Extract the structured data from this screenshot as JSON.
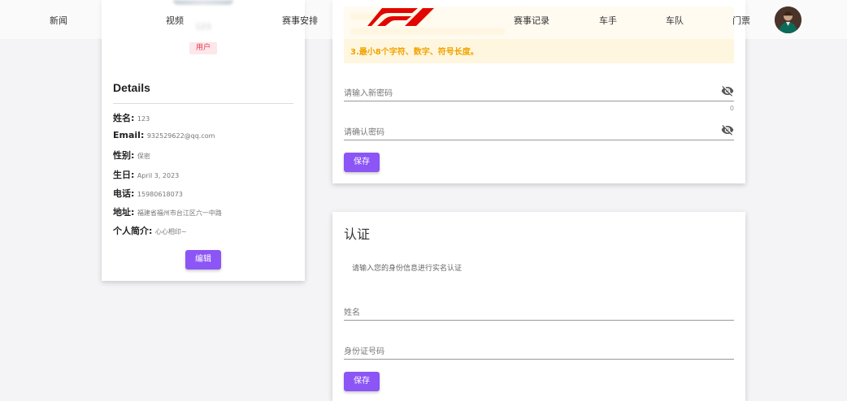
{
  "nav": {
    "items": [
      "新闻",
      "视频",
      "赛事安排",
      "赛事记录",
      "车手",
      "车队",
      "门票"
    ],
    "brand_color": "#e10600"
  },
  "profile": {
    "username": "123",
    "role": "用户",
    "details_title": "Details",
    "rows": [
      {
        "label": "姓名:",
        "value": "123"
      },
      {
        "label": "Email:",
        "value": "932529622@qq.com"
      },
      {
        "label": "性别:",
        "value": "保密"
      },
      {
        "label": "生日:",
        "value": "April 3, 2023"
      },
      {
        "label": "电话:",
        "value": "15980618073"
      },
      {
        "label": "地址:",
        "value": "福建省福州市台江区六一中路"
      },
      {
        "label": "个人简介:",
        "value": "心心相印~"
      }
    ],
    "edit_label": "编辑"
  },
  "password": {
    "tip_line3": "3.最小8个字符、数字、符号长度。",
    "new_placeholder": "请输入新密码",
    "counter": "0",
    "confirm_placeholder": "请确认密码",
    "save_label": "保存"
  },
  "auth": {
    "title": "认证",
    "description": "请输入您的身份信息进行实名认证",
    "name_placeholder": "姓名",
    "id_placeholder": "身份证号码",
    "save_label": "保存"
  },
  "colors": {
    "accent": "#8c55f5",
    "tip_bg": "#fff6df",
    "tip_text": "#f0a400",
    "badge_bg": "#fde7ea",
    "badge_text": "#e53950"
  }
}
